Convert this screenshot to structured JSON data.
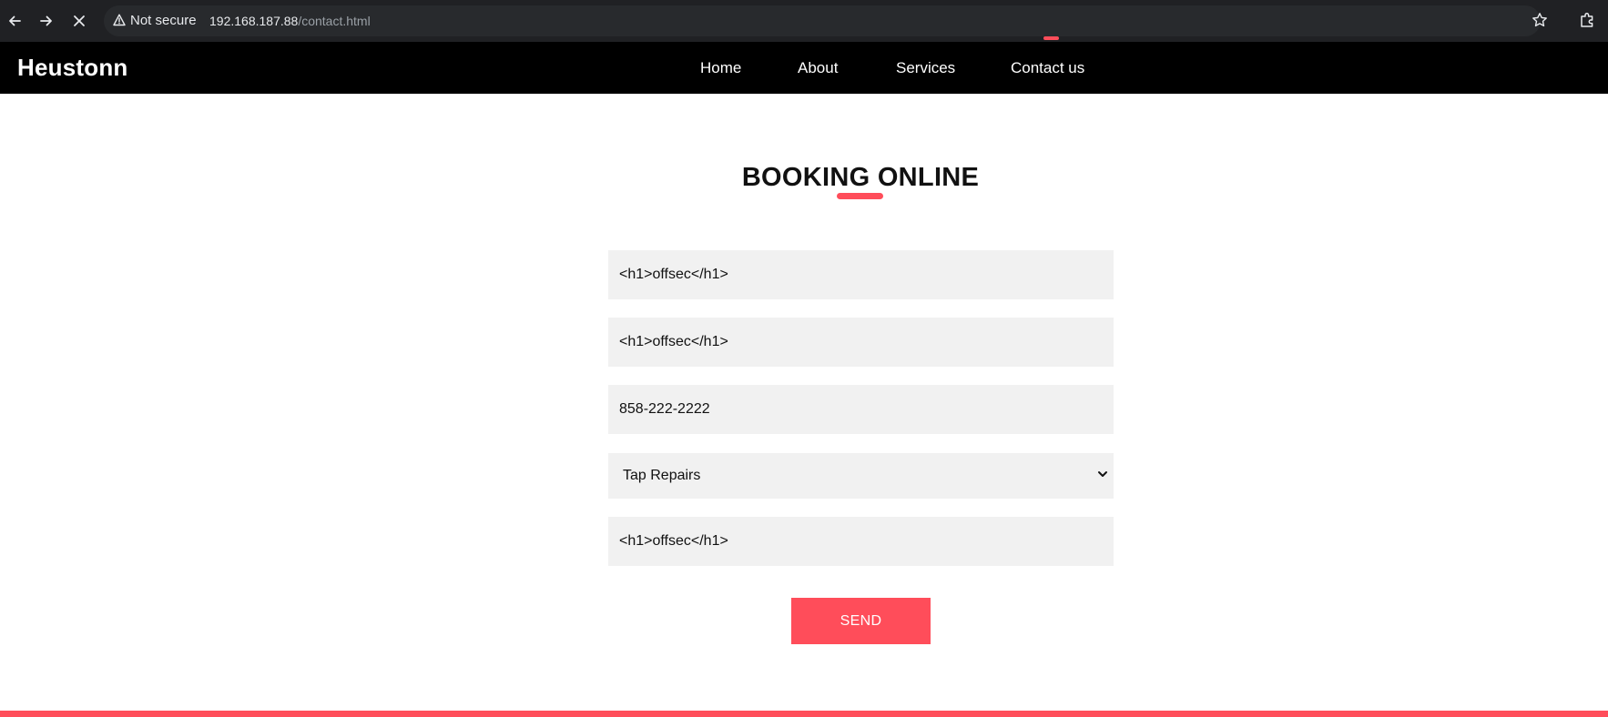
{
  "browser": {
    "security_label": "Not secure",
    "url_host": "192.168.187.88",
    "url_path": "/contact.html",
    "icons": [
      "back-arrow-icon",
      "forward-arrow-icon",
      "stop-loading-icon",
      "warning-triangle-icon",
      "bookmark-star-icon",
      "extensions-puzzle-icon"
    ]
  },
  "site": {
    "brand": "Heustonn",
    "nav": [
      {
        "label": "Home"
      },
      {
        "label": "About"
      },
      {
        "label": "Services"
      },
      {
        "label": "Contact us",
        "active": true
      }
    ]
  },
  "booking": {
    "title": "BOOKING ONLINE",
    "fields": {
      "name_value": "<h1>offsec</h1>",
      "email_value": "<h1>offsec</h1>",
      "phone_value": "858-222-2222",
      "service_selected": "Tap Repairs",
      "message_value": "<h1>offsec</h1>"
    },
    "submit_label": "SEND"
  },
  "colors": {
    "accent": "#ff4d5a",
    "header_bg": "#000000",
    "field_bg": "#f1f1f1",
    "chrome_bg": "#202124"
  }
}
